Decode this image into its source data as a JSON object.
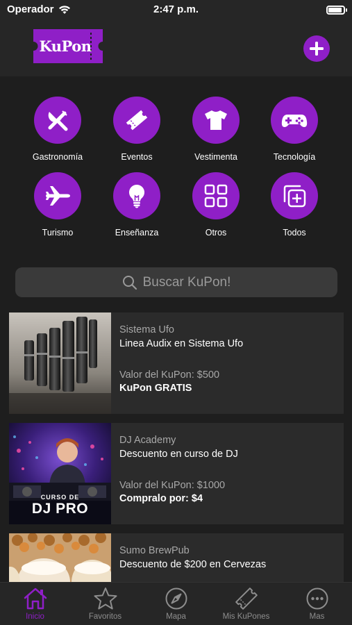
{
  "status_bar": {
    "carrier": "Operador",
    "time": "2:47 p.m."
  },
  "header": {
    "logo_text": "KuPon"
  },
  "colors": {
    "accent": "#8f1fc7",
    "background": "#1e1e1e",
    "card": "#2b2b2b"
  },
  "categories": [
    {
      "label": "Gastronomía",
      "icon": "fork-knife-icon"
    },
    {
      "label": "Eventos",
      "icon": "ticket-icon"
    },
    {
      "label": "Vestimenta",
      "icon": "shirt-icon"
    },
    {
      "label": "Tecnología",
      "icon": "gamepad-icon"
    },
    {
      "label": "Turismo",
      "icon": "airplane-icon"
    },
    {
      "label": "Enseñanza",
      "icon": "lightbulb-icon"
    },
    {
      "label": "Otros",
      "icon": "grid-icon"
    },
    {
      "label": "Todos",
      "icon": "stack-plus-icon"
    }
  ],
  "search": {
    "placeholder": "Buscar KuPon!"
  },
  "coupons": [
    {
      "store": "Sistema Ufo",
      "title": "Linea Audix en Sistema Ufo",
      "value": "Valor del KuPon: $500",
      "price": "KuPon GRATIS"
    },
    {
      "store": "DJ Academy",
      "title": "Descuento en curso de DJ",
      "value": "Valor del KuPon: $1000",
      "price": "Compralo por: $4",
      "image_caption_top": "CURSO DE",
      "image_caption_main": "DJ PRO"
    },
    {
      "store": "Sumo BrewPub",
      "title": "Descuento de $200 en Cervezas"
    }
  ],
  "tabs": [
    {
      "label": "Inicio",
      "icon": "home-icon",
      "active": true
    },
    {
      "label": "Favoritos",
      "icon": "star-icon"
    },
    {
      "label": "Mapa",
      "icon": "compass-icon"
    },
    {
      "label": "Mis KuPones",
      "icon": "ticket-icon"
    },
    {
      "label": "Mas",
      "icon": "more-icon"
    }
  ]
}
